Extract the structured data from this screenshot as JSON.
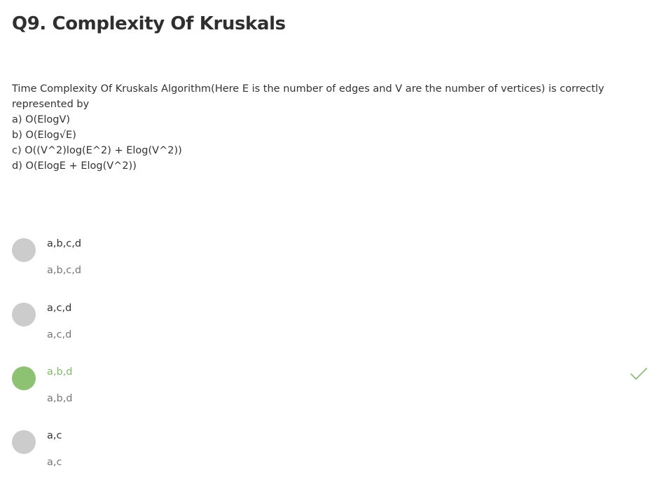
{
  "question": {
    "title": "Q9. Complexity Of Kruskals",
    "stem": "Time Complexity Of Kruskals Algorithm(Here E is the number of edges and V are the number of vertices) is correctly represented by",
    "statements": [
      "a) O(ElogV)",
      "b) O(Elog√E)",
      "c) O((V^2)log(E^2) + Elog(V^2))",
      "d) O(ElogE + Elog(V^2))"
    ]
  },
  "options": [
    {
      "label": "a,b,c,d",
      "sub": "a,b,c,d",
      "correct": false
    },
    {
      "label": "a,c,d",
      "sub": "a,c,d",
      "correct": false
    },
    {
      "label": "a,b,d",
      "sub": "a,b,d",
      "correct": true
    },
    {
      "label": "a,c",
      "sub": "a,c",
      "correct": false
    }
  ],
  "colors": {
    "radio_default": "#cccccc",
    "radio_correct": "#8cc271",
    "correct_text": "#7cbf63",
    "check_mark": "#8cc271"
  },
  "icons": {
    "correct_indicator": "check-icon"
  }
}
